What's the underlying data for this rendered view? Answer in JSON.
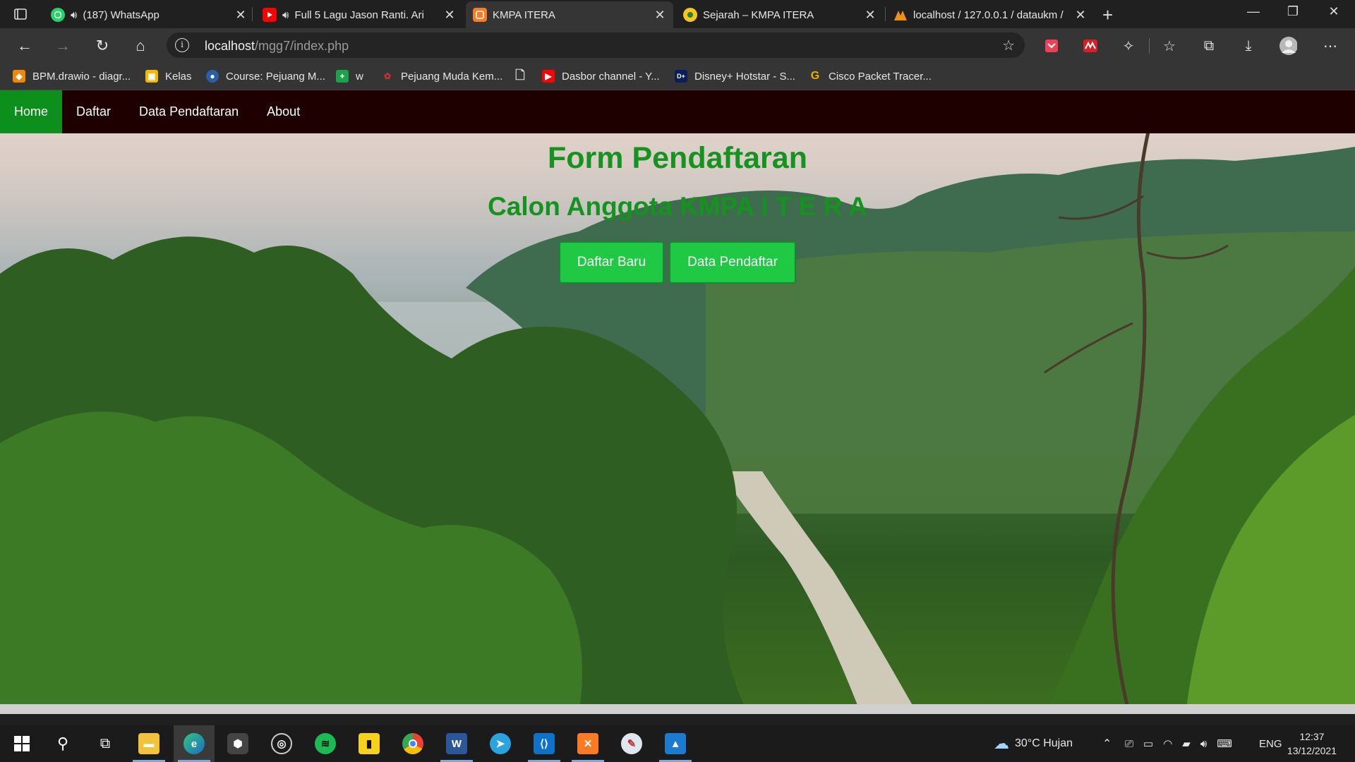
{
  "browser": {
    "tabs": [
      {
        "title": "(187) WhatsApp",
        "favicon": "whatsapp-icon",
        "audio": true
      },
      {
        "title": "Full 5 Lagu Jason Ranti. Ari",
        "favicon": "youtube-icon",
        "audio": true
      },
      {
        "title": "KMPA ITERA",
        "favicon": "xampp-icon",
        "active": true
      },
      {
        "title": "Sejarah – KMPA ITERA",
        "favicon": "kmpa-logo-icon"
      },
      {
        "title": "localhost / 127.0.0.1 / dataukm /",
        "favicon": "phpmyadmin-icon"
      }
    ],
    "address": {
      "host": "localhost",
      "path": "/mgg7/index.php"
    },
    "bookmarks": [
      {
        "label": "BPM.drawio - diagr...",
        "icon": "drawio-icon"
      },
      {
        "label": "Kelas",
        "icon": "classroom-icon"
      },
      {
        "label": "Course: Pejuang M...",
        "icon": "course-icon"
      },
      {
        "label": "w",
        "icon": "green-cross-icon"
      },
      {
        "label": "Pejuang Muda Kem...",
        "icon": "red-logo-icon"
      },
      {
        "label": "",
        "icon": "page-icon"
      },
      {
        "label": "Dasbor channel - Y...",
        "icon": "youtube-icon"
      },
      {
        "label": "Disney+ Hotstar - S...",
        "icon": "disney-icon"
      },
      {
        "label": "Cisco Packet Tracer...",
        "icon": "google-icon"
      }
    ]
  },
  "site": {
    "nav": [
      {
        "label": "Home",
        "active": true
      },
      {
        "label": "Daftar"
      },
      {
        "label": "Data Pendaftaran"
      },
      {
        "label": "About"
      }
    ],
    "title": "Form Pendaftaran",
    "subtitle": "Calon Anggota KMPA I T E R A",
    "buttons": {
      "primary": "Daftar Baru",
      "secondary": "Data Pendaftar"
    },
    "colors": {
      "accent": "#14931f",
      "nav_bg": "#1f0000",
      "active_nav": "#0c8f1c",
      "button": "#1fc944"
    }
  },
  "taskbar": {
    "apps": [
      "start-icon",
      "search-icon",
      "task-view-icon",
      "file-explorer-icon",
      "edge-icon",
      "obs-icon",
      "aperture-icon",
      "spotify-icon",
      "sticky-notes-icon",
      "chrome-icon",
      "word-icon",
      "telegram-icon",
      "vscode-icon",
      "xampp-icon",
      "paint-icon",
      "photos-icon"
    ],
    "weather": "30°C  Hujan",
    "language": "ENG",
    "time": "12:37",
    "date": "13/12/2021"
  }
}
